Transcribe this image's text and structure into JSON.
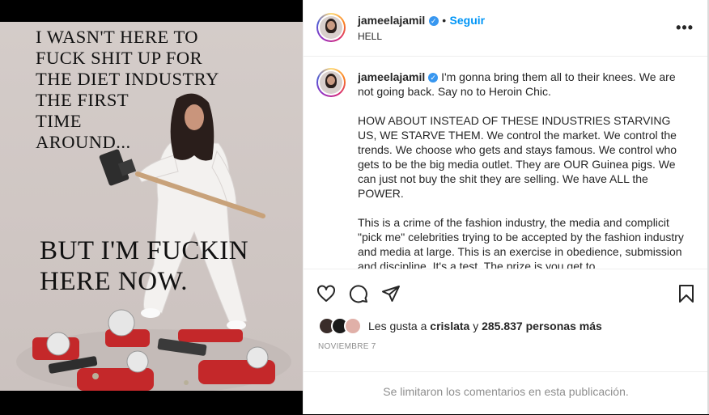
{
  "post": {
    "image": {
      "poster_top_lines": [
        "I WASN'T HERE TO",
        "FUCK SHIT UP FOR",
        "THE DIET INDUSTRY",
        "THE FIRST",
        "TIME",
        "AROUND..."
      ],
      "poster_big_lines": [
        "BUT I'M FUCKIN",
        "HERE NOW."
      ]
    },
    "header": {
      "username": "jameelajamil",
      "separator": "•",
      "follow_label": "Seguir",
      "location": "HELL",
      "more_icon": "more-horizontal-icon"
    },
    "caption": {
      "username": "jameelajamil",
      "first_line": "I'm gonna bring them all to their knees. We are not going back. Say no to Heroin Chic.",
      "paragraph_2": "HOW ABOUT INSTEAD OF THESE INDUSTRIES STARVING US, WE STARVE THEM. We control the market. We control the trends. We choose who gets and stays famous. We control who gets to be the big media outlet. They are OUR Guinea pigs. We can just not buy the shit they are selling. We have ALL the POWER.",
      "paragraph_3": "This is a crime of the fashion industry, the media and complicit \"pick me\" celebrities trying to be accepted by the fashion industry and media at large. This is an exercise in obedience, submission and discipline. It's a test. The prize is you get to"
    },
    "actions": {
      "like_icon": "heart-icon",
      "comment_icon": "comment-icon",
      "share_icon": "share-icon",
      "save_icon": "bookmark-icon"
    },
    "likes": {
      "prefix": "Les gusta a",
      "user": "crislata",
      "conj": "y",
      "count_text": "285.837 personas más"
    },
    "date": "NOVIEMBRE 7",
    "comments_notice": "Se limitaron los comentarios en esta publicación.",
    "colors": {
      "link_blue": "#0095f6",
      "verified_blue": "#3897f0",
      "text": "#262626",
      "muted": "#8e8e8e"
    }
  }
}
